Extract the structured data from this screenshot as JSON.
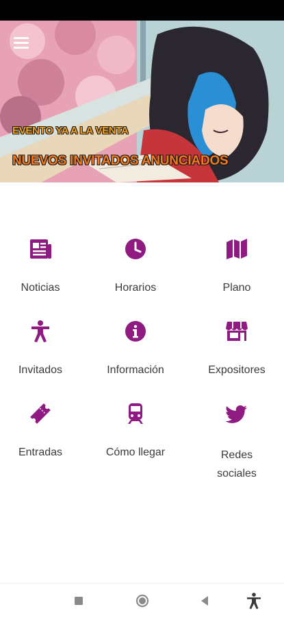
{
  "hero": {
    "line1": "EVENTO YA A LA VENTA",
    "line2": "NUEVOS INVITADOS ANUNCIADOS"
  },
  "menu": [
    {
      "label": "Noticias",
      "icon": "newspaper-icon"
    },
    {
      "label": "Horarios",
      "icon": "clock-icon"
    },
    {
      "label": "Plano",
      "icon": "map-icon"
    },
    {
      "label": "Invitados",
      "icon": "person-icon"
    },
    {
      "label": "Información",
      "icon": "info-icon"
    },
    {
      "label": "Expositores",
      "icon": "store-icon"
    },
    {
      "label": "Entradas",
      "icon": "ticket-icon"
    },
    {
      "label": "Cómo llegar",
      "icon": "train-icon"
    },
    {
      "label": "Redes sociales",
      "icon": "twitter-icon"
    }
  ],
  "colors": {
    "accent": "#8e1a82",
    "text": "#3a3a3a",
    "status_bar": "#000000"
  },
  "nav": [
    "square-icon",
    "circle-icon",
    "back-triangle-icon",
    "accessibility-icon"
  ]
}
